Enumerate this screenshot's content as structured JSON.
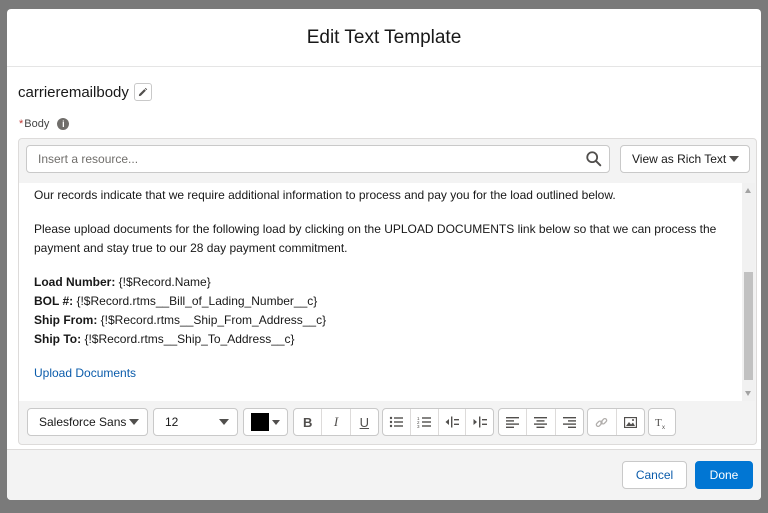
{
  "modal": {
    "title": "Edit Text Template"
  },
  "template": {
    "name": "carrieremailbody"
  },
  "body_field": {
    "label": "Body",
    "required_marker": "*"
  },
  "search": {
    "placeholder": "Insert a resource..."
  },
  "view_mode": {
    "selected": "View as Rich Text"
  },
  "content": {
    "para1": "Our records indicate that we require additional information to process and pay you for the load outlined below.",
    "para2_line1": "Please upload documents for the following load by clicking on the UPLOAD DOCUMENTS link below so that we can process the",
    "para2_line2": "payment and stay true to our 28 day payment commitment.",
    "fields": [
      {
        "label": "Load Number:",
        "value": " {!$Record.Name}"
      },
      {
        "label": "BOL #:",
        "value": "  {!$Record.rtms__Bill_of_Lading_Number__c}"
      },
      {
        "label": "Ship From:",
        "value": " {!$Record.rtms__Ship_From_Address__c}"
      },
      {
        "label": "Ship To:",
        "value": "  {!$Record.rtms__Ship_To_Address__c}"
      }
    ],
    "link_text": "Upload Documents"
  },
  "toolbar": {
    "font_family": "Salesforce Sans",
    "font_size": "12",
    "text_color": "#000000",
    "bold_label": "B",
    "italic_label": "I",
    "underline_label": "U"
  },
  "footer": {
    "cancel_label": "Cancel",
    "done_label": "Done"
  },
  "colors": {
    "brand": "#0176d3",
    "link": "#0b5cab",
    "required": "#c23934"
  }
}
